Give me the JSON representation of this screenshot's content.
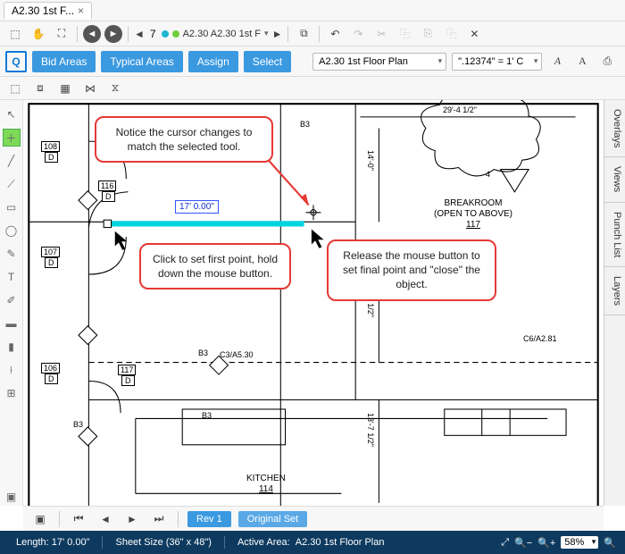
{
  "tab": {
    "title": "A2.30 1st F...",
    "close": "×"
  },
  "nav": {
    "page_num": "7",
    "page_label": "A2.30 A2.30 1st F"
  },
  "toolbar2": {
    "bid_areas": "Bid Areas",
    "typical_areas": "Typical Areas",
    "assign": "Assign",
    "select": "Select",
    "sheet_dropdown": "A2.30 1st Floor Plan",
    "scale_dropdown": "\".12374\" = 1' C"
  },
  "callouts": {
    "c1": "Notice the cursor changes to match the selected tool.",
    "c2": "Click to set first point, hold down the mouse button.",
    "c3": "Release the mouse button to set final point and \"close\" the object."
  },
  "measurement": "17' 0.00\"",
  "drawing": {
    "breakroom": "BREAKROOM",
    "breakroom_sub": "(OPEN TO ABOVE)",
    "breakroom_num": "117",
    "kitchen": "KITCHEN",
    "kitchen_num": "114",
    "dim_top": "29'-4 1/2\"",
    "dim_right1": "14'-0\"",
    "dim_right2": "5'-8 1/2\"",
    "dim_right3": "13'-7 1/2\"",
    "ref_c6": "C6/A2.81",
    "ref_c3": "C3/A5.30",
    "bubble4": "4",
    "tag108": "108",
    "tagD": "D",
    "tag116": "116",
    "tag107": "107",
    "tag106": "106",
    "tag117b": "117",
    "tagB3a": "B3",
    "tagB3b": "B3",
    "tagB3c": "B3",
    "tagB3d": "B3"
  },
  "bottom": {
    "rev": "Rev 1",
    "set": "Original Set"
  },
  "status": {
    "length_label": "Length:",
    "length_val": "17' 0.00\"",
    "sheet_label": "Sheet Size (36\" x 48\")",
    "area_label": "Active Area:",
    "area_val": "A2.30 1st Floor Plan",
    "zoom": "58%"
  },
  "side_tabs": {
    "overlays": "Overlays",
    "views": "Views",
    "punch": "Punch List",
    "layers": "Layers"
  }
}
